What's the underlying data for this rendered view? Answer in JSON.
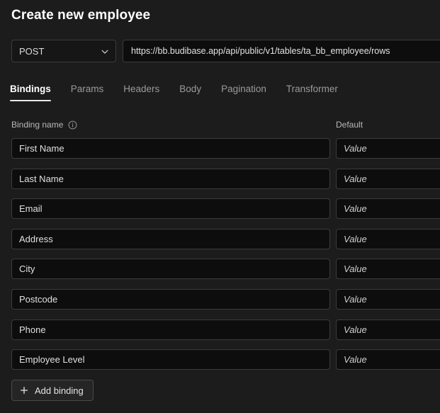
{
  "header": {
    "title": "Create new employee"
  },
  "request": {
    "method": "POST",
    "method_icon": "chevron-down-icon",
    "url": "https://bb.budibase.app/api/public/v1/tables/ta_bb_employee/rows"
  },
  "tabs": [
    {
      "label": "Bindings",
      "active": true
    },
    {
      "label": "Params",
      "active": false
    },
    {
      "label": "Headers",
      "active": false
    },
    {
      "label": "Body",
      "active": false
    },
    {
      "label": "Pagination",
      "active": false
    },
    {
      "label": "Transformer",
      "active": false
    }
  ],
  "columns": {
    "binding_name": "Binding name",
    "binding_name_icon": "info-icon",
    "default": "Default"
  },
  "bindings": [
    {
      "name": "First Name",
      "value_placeholder": "Value"
    },
    {
      "name": "Last Name",
      "value_placeholder": "Value"
    },
    {
      "name": "Email",
      "value_placeholder": "Value"
    },
    {
      "name": "Address",
      "value_placeholder": "Value"
    },
    {
      "name": "City",
      "value_placeholder": "Value"
    },
    {
      "name": "Postcode",
      "value_placeholder": "Value"
    },
    {
      "name": "Phone",
      "value_placeholder": "Value"
    },
    {
      "name": "Employee Level",
      "value_placeholder": "Value"
    }
  ],
  "actions": {
    "add_binding": "Add binding",
    "add_binding_icon": "plus-icon"
  },
  "colors": {
    "page_background": "#1c1c1c",
    "field_background": "#0d0d0d",
    "field_border": "#3c3c3c",
    "text_primary": "#e8e8e8",
    "text_muted": "#9a9a9a",
    "active_tab_underline": "#e8e8e8"
  }
}
